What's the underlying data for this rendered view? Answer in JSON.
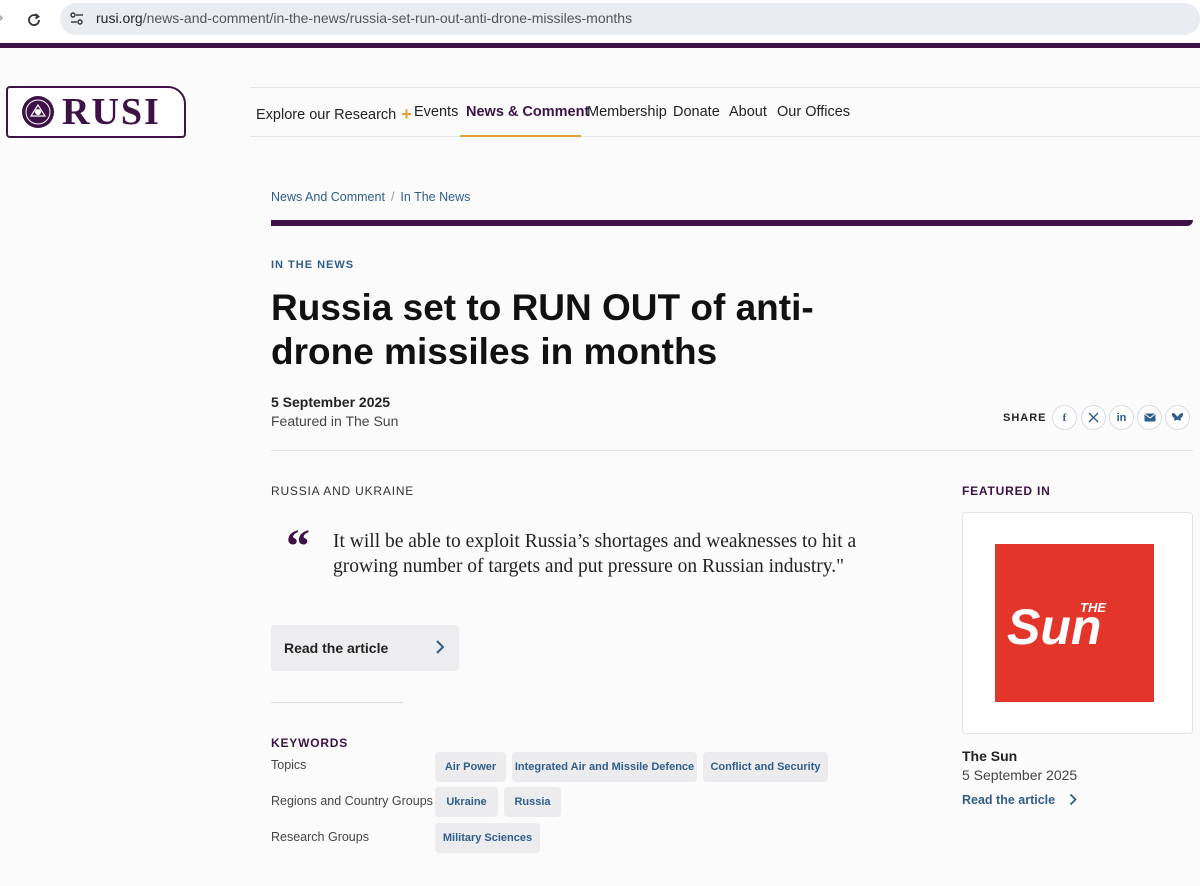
{
  "browser": {
    "url_domain": "rusi.org",
    "url_path": "/news-and-comment/in-the-news/russia-set-run-out-anti-drone-missiles-months"
  },
  "header": {
    "logo_text": "RUSI",
    "nav": [
      "Explore our Research",
      "Events",
      "News & Comment",
      "Membership",
      "Donate",
      "About",
      "Our Offices"
    ],
    "active_nav": "News & Comment"
  },
  "breadcrumb": [
    "News And Comment",
    "In The News"
  ],
  "article": {
    "kicker": "IN THE NEWS",
    "title": "Russia set to RUN OUT of anti-drone missiles in months",
    "date": "5 September 2025",
    "featured_in": "Featured in The Sun",
    "section": "RUSSIA AND UKRAINE",
    "quote": "It will be able to exploit Russia’s shortages and weaknesses to hit a growing number of targets and put pressure on Russian industry.\"",
    "read_button": "Read the article"
  },
  "share": {
    "label": "SHARE",
    "icons": [
      "facebook-icon",
      "x-icon",
      "linkedin-icon",
      "email-icon",
      "bluesky-icon"
    ]
  },
  "keywords": {
    "heading": "KEYWORDS",
    "topics_label": "Topics",
    "topics": [
      "Air Power",
      "Integrated Air and Missile Defence",
      "Conflict and Security"
    ],
    "regions_label": "Regions and Country Groups",
    "regions": [
      "Ukraine",
      "Russia"
    ],
    "research_label": "Research Groups",
    "research": [
      "Military Sciences"
    ]
  },
  "sidebar": {
    "label": "FEATURED IN",
    "publication": "The Sun",
    "logo_text_small": "THE",
    "logo_text_big": "Sun",
    "date": "5 September 2025",
    "link": "Read the article"
  },
  "colors": {
    "brand_purple": "#3d1247",
    "accent_gold": "#e0a33a",
    "link_blue": "#2f5d8a",
    "sun_red": "#e4352b"
  }
}
